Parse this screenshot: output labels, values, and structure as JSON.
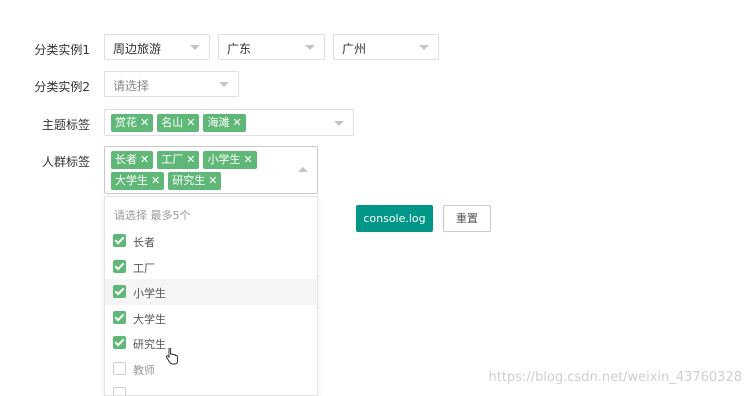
{
  "rows": {
    "row1": {
      "label": "分类实例1",
      "selects": [
        {
          "value": "周边旅游"
        },
        {
          "value": "广东"
        },
        {
          "value": "广州"
        }
      ]
    },
    "row2": {
      "label": "分类实例2",
      "placeholder": "请选择"
    },
    "row3": {
      "label": "主题标签",
      "tags": [
        "赏花",
        "名山",
        "海滩"
      ]
    },
    "row4": {
      "label": "人群标签",
      "tags": [
        "长者",
        "工厂",
        "小学生",
        "大学生",
        "研究生"
      ]
    }
  },
  "dropdown": {
    "hint": "请选择 最多5个",
    "options": [
      {
        "label": "长者",
        "checked": true
      },
      {
        "label": "工厂",
        "checked": true
      },
      {
        "label": "小学生",
        "checked": true
      },
      {
        "label": "大学生",
        "checked": true
      },
      {
        "label": "研究生",
        "checked": true
      },
      {
        "label": "教师",
        "checked": false
      }
    ]
  },
  "buttons": {
    "console_label": "console.log",
    "reset_label": "重置"
  },
  "tag_close_glyph": "✕",
  "watermark": "https://blog.csdn.net/weixin_43760328",
  "colors": {
    "tag": "#5fb878",
    "primary": "#009688",
    "border": "#dcdfe6"
  }
}
